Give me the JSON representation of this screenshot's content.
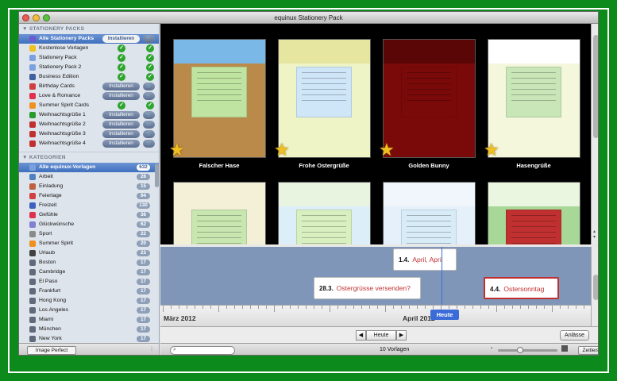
{
  "window": {
    "title": "equinux Stationery Pack"
  },
  "colors": {
    "background": "#0c8a1c",
    "selection": "#3f6fbd",
    "accent_red": "#c03030",
    "timeline_bg": "#7f96b8"
  },
  "sidebar": {
    "packs_header": "STATIONERY PACKS",
    "packs": [
      {
        "label": "Alle Stationery Packs",
        "install": "Installieren",
        "cart": "🛒",
        "icon": "pack-icon",
        "color": "#6b5bd0"
      },
      {
        "label": "Kostenlose Vorlagen",
        "check": true,
        "icon": "star-icon",
        "color": "#f0c020"
      },
      {
        "label": "Stationery Pack",
        "check": true,
        "icon": "pack-icon",
        "color": "#7aa0e0"
      },
      {
        "label": "Stationery Pack 2",
        "check": true,
        "icon": "pack-icon",
        "color": "#7aa0e0"
      },
      {
        "label": "Business Edition",
        "check": true,
        "icon": "briefcase-icon",
        "color": "#4060a0"
      },
      {
        "label": "Birthday Cards",
        "install": "Installieren",
        "cart": "🛒",
        "icon": "gift-icon",
        "color": "#d04040"
      },
      {
        "label": "Love & Romance",
        "install": "Installieren",
        "cart": "🛒",
        "icon": "heart-icon",
        "color": "#e03050"
      },
      {
        "label": "Summer Spirit Cards",
        "check": true,
        "icon": "sun-icon",
        "color": "#f09020"
      },
      {
        "label": "Weihnachtsgrüße 1",
        "install": "Installieren",
        "cart": "🛒",
        "icon": "tree-icon",
        "color": "#2a9a2a"
      },
      {
        "label": "Weihnachtsgrüße 2",
        "install": "Installieren",
        "cart": "🛒",
        "icon": "ornament-icon",
        "color": "#c03030"
      },
      {
        "label": "Weihnachtsgrüße 3",
        "install": "Installieren",
        "cart": "🛒",
        "icon": "ornament-icon",
        "color": "#c03030"
      },
      {
        "label": "Weihnachtsgrüße 4",
        "install": "Installieren",
        "cart": "🛒",
        "icon": "ornament-icon",
        "color": "#c03030"
      }
    ],
    "check_mark": "✓",
    "categories_header": "KATEGORIEN",
    "categories": [
      {
        "label": "Alle equinux-Vorlagen",
        "count": "632",
        "icon": "stack-icon",
        "color": "#7aa0e0"
      },
      {
        "label": "Arbeit",
        "count": "26",
        "icon": "pencil-icon",
        "color": "#5080c0"
      },
      {
        "label": "Einladung",
        "count": "15",
        "icon": "envelope-icon",
        "color": "#c06040"
      },
      {
        "label": "Feiertage",
        "count": "94",
        "icon": "flag-icon",
        "color": "#d04040"
      },
      {
        "label": "Freizeit",
        "count": "130",
        "icon": "music-icon",
        "color": "#4060c0"
      },
      {
        "label": "Gefühle",
        "count": "36",
        "icon": "heart-icon",
        "color": "#e03050"
      },
      {
        "label": "Glückwünsche",
        "count": "62",
        "icon": "balloon-icon",
        "color": "#8080d0"
      },
      {
        "label": "Sport",
        "count": "22",
        "icon": "ball-icon",
        "color": "#8a8a8a"
      },
      {
        "label": "Summer Spirit",
        "count": "20",
        "icon": "sun-icon",
        "color": "#f09020"
      },
      {
        "label": "Urlaub",
        "count": "23",
        "icon": "camera-icon",
        "color": "#404040"
      },
      {
        "label": "Boston",
        "count": "17",
        "icon": "city-icon",
        "color": "#606a7a"
      },
      {
        "label": "Cambridge",
        "count": "17",
        "icon": "city-icon",
        "color": "#606a7a"
      },
      {
        "label": "El Paso",
        "count": "17",
        "icon": "city-icon",
        "color": "#606a7a"
      },
      {
        "label": "Frankfurt",
        "count": "17",
        "icon": "city-icon",
        "color": "#606a7a"
      },
      {
        "label": "Hong Kong",
        "count": "17",
        "icon": "city-icon",
        "color": "#606a7a"
      },
      {
        "label": "Los Angeles",
        "count": "17",
        "icon": "city-icon",
        "color": "#606a7a"
      },
      {
        "label": "Miami",
        "count": "17",
        "icon": "city-icon",
        "color": "#606a7a"
      },
      {
        "label": "München",
        "count": "17",
        "icon": "city-icon",
        "color": "#606a7a"
      },
      {
        "label": "New York",
        "count": "17",
        "icon": "city-icon",
        "color": "#606a7a"
      }
    ],
    "image_perfect_button": "Image Perfect"
  },
  "templates": [
    {
      "caption": "Falscher Hase",
      "starred": true,
      "bg": "#b98a4a",
      "top": "#7ab8e8",
      "note": "#bfe3a0"
    },
    {
      "caption": "Frohe Ostergrüße",
      "starred": true,
      "bg": "#eef4c6",
      "top": "#e6e6a0",
      "note": "#cfe6f8"
    },
    {
      "caption": "Golden Bunny",
      "starred": true,
      "bg": "#7a0a0a",
      "top": "#5a0606",
      "note": "#7a0a0a"
    },
    {
      "caption": "Hasengrüße",
      "starred": true,
      "bg": "#f4f7dc",
      "top": "#ffffff",
      "note": "#c8e6b8"
    },
    {
      "caption": "",
      "starred": false,
      "bg": "#f4f0d8",
      "top": "#f4f0d8",
      "note": "#c8e6b0"
    },
    {
      "caption": "",
      "starred": false,
      "bg": "#dceef8",
      "top": "#e8f4e0",
      "note": "#d8f0c0"
    },
    {
      "caption": "",
      "starred": false,
      "bg": "#e6f0fa",
      "top": "#f0f6fc",
      "note": "#d8ecf8"
    },
    {
      "caption": "",
      "starred": false,
      "bg": "#a8d898",
      "top": "#eaf6e0",
      "note": "#c03030"
    }
  ],
  "star_glyph": "★",
  "timeline": {
    "events": [
      {
        "date": "1.4.",
        "title": "April, April",
        "highlight": false
      },
      {
        "date": "28.3.",
        "title": "Ostergrüsse versenden?",
        "highlight": false
      },
      {
        "date": "4.4.",
        "title": "Ostersonntag",
        "highlight": true
      }
    ],
    "months": [
      "März 2012",
      "April 2012"
    ],
    "today_marker": "Heute"
  },
  "navigation": {
    "prev": "◀",
    "today": "Heute",
    "next": "▶",
    "occasions_button": "Anlässe"
  },
  "status": {
    "count_text": "10 Vorlagen",
    "timeline_button": "Zeitleiste",
    "search_placeholder": ""
  }
}
